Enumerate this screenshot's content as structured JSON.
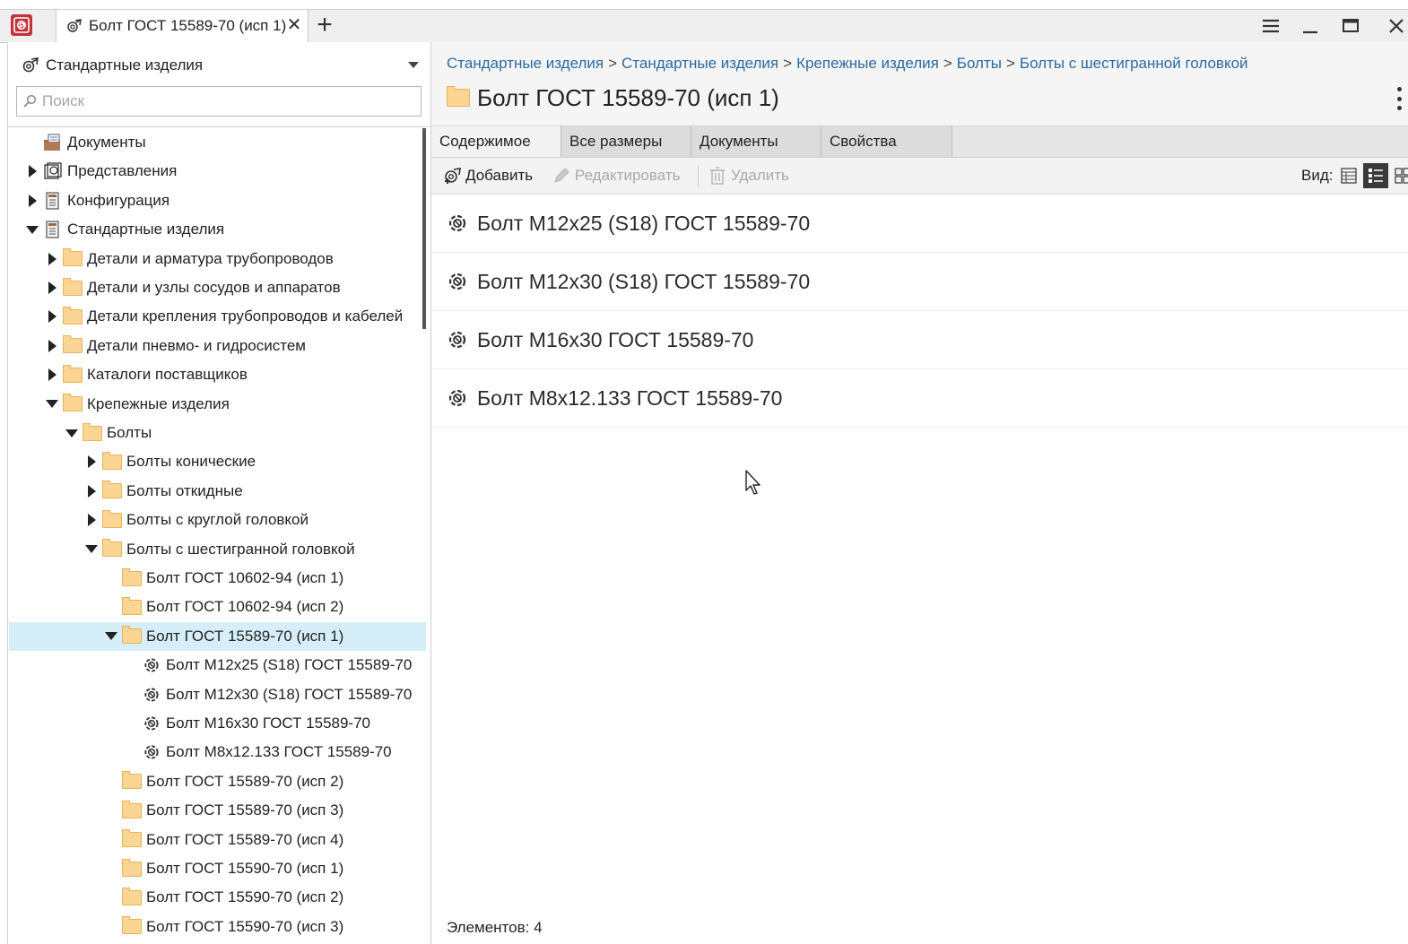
{
  "window": {
    "tab_title": "Болт ГОСТ 15589-70 (исп 1)",
    "tab_close": "✕",
    "new_tab": "+"
  },
  "left": {
    "library_name": "Стандартные изделия",
    "search_placeholder": "Поиск",
    "tree": [
      {
        "label": "Документы",
        "level": 1,
        "expander": "none",
        "icon": "documents-icon"
      },
      {
        "label": "Представления",
        "level": 1,
        "expander": "collapsed",
        "icon": "views-icon"
      },
      {
        "label": "Конфигурация",
        "level": 1,
        "expander": "collapsed",
        "icon": "config-icon"
      },
      {
        "label": "Стандартные изделия",
        "level": 1,
        "expander": "expanded",
        "icon": "config-icon"
      },
      {
        "label": "Детали и арматура трубопроводов",
        "level": 2,
        "expander": "collapsed",
        "icon": "folder-icon"
      },
      {
        "label": "Детали и узлы сосудов и аппаратов",
        "level": 2,
        "expander": "collapsed",
        "icon": "folder-icon"
      },
      {
        "label": "Детали крепления трубопроводов и кабелей",
        "level": 2,
        "expander": "collapsed",
        "icon": "folder-icon"
      },
      {
        "label": "Детали пневмо- и гидросистем",
        "level": 2,
        "expander": "collapsed",
        "icon": "folder-icon"
      },
      {
        "label": "Каталоги поставщиков",
        "level": 2,
        "expander": "collapsed",
        "icon": "folder-icon"
      },
      {
        "label": "Крепежные изделия",
        "level": 2,
        "expander": "expanded",
        "icon": "folder-icon"
      },
      {
        "label": "Болты",
        "level": 3,
        "expander": "expanded",
        "icon": "folder-icon"
      },
      {
        "label": "Болты конические",
        "level": 4,
        "expander": "collapsed",
        "icon": "folder-icon"
      },
      {
        "label": "Болты откидные",
        "level": 4,
        "expander": "collapsed",
        "icon": "folder-icon"
      },
      {
        "label": "Болты с круглой головкой",
        "level": 4,
        "expander": "collapsed",
        "icon": "folder-icon"
      },
      {
        "label": "Болты с шестигранной головкой",
        "level": 4,
        "expander": "expanded",
        "icon": "folder-icon"
      },
      {
        "label": "Болт ГОСТ 10602-94 (исп 1)",
        "level": 5,
        "expander": "none",
        "icon": "folder-icon"
      },
      {
        "label": "Болт ГОСТ 10602-94 (исп 2)",
        "level": 5,
        "expander": "none",
        "icon": "folder-icon"
      },
      {
        "label": "Болт ГОСТ 15589-70 (исп 1)",
        "level": 5,
        "expander": "expanded",
        "icon": "folder-icon",
        "selected": true
      },
      {
        "label": "Болт М12х25 (S18) ГОСТ 15589-70",
        "level": 6,
        "expander": "none",
        "icon": "part-icon"
      },
      {
        "label": "Болт М12х30 (S18) ГОСТ 15589-70",
        "level": 6,
        "expander": "none",
        "icon": "part-icon"
      },
      {
        "label": "Болт М16х30 ГОСТ 15589-70",
        "level": 6,
        "expander": "none",
        "icon": "part-icon"
      },
      {
        "label": "Болт М8х12.133 ГОСТ 15589-70",
        "level": 6,
        "expander": "none",
        "icon": "part-icon"
      },
      {
        "label": "Болт ГОСТ 15589-70 (исп 2)",
        "level": 5,
        "expander": "none",
        "icon": "folder-icon"
      },
      {
        "label": "Болт ГОСТ 15589-70 (исп 3)",
        "level": 5,
        "expander": "none",
        "icon": "folder-icon"
      },
      {
        "label": "Болт ГОСТ 15589-70 (исп 4)",
        "level": 5,
        "expander": "none",
        "icon": "folder-icon"
      },
      {
        "label": "Болт ГОСТ 15590-70 (исп 1)",
        "level": 5,
        "expander": "none",
        "icon": "folder-icon"
      },
      {
        "label": "Болт ГОСТ 15590-70 (исп 2)",
        "level": 5,
        "expander": "none",
        "icon": "folder-icon"
      },
      {
        "label": "Болт ГОСТ 15590-70 (исп 3)",
        "level": 5,
        "expander": "none",
        "icon": "folder-icon"
      }
    ]
  },
  "breadcrumb": [
    "Стандартные изделия",
    "Стандартные изделия",
    "Крепежные изделия",
    "Болты",
    "Болты с шестигранной головкой"
  ],
  "breadcrumb_separator": ">",
  "page_title": "Болт ГОСТ 15589-70 (исп 1)",
  "tabs": [
    {
      "label": "Содержимое",
      "active": true
    },
    {
      "label": "Все размеры",
      "active": false
    },
    {
      "label": "Документы",
      "active": false
    },
    {
      "label": "Свойства",
      "active": false
    }
  ],
  "toolbar": {
    "add_label": "Добавить",
    "edit_label": "Редактировать",
    "delete_label": "Удалить",
    "view_label": "Вид:"
  },
  "content_items": [
    "Болт М12х25 (S18) ГОСТ 15589-70",
    "Болт М12х30 (S18) ГОСТ 15589-70",
    "Болт М16х30 ГОСТ 15589-70",
    "Болт М8х12.133 ГОСТ 15589-70"
  ],
  "status": "Элементов: 4",
  "colors": {
    "accent_link": "#2c6aa0",
    "selected_row": "#d6eef7",
    "folder": "#fad593",
    "app_icon": "#c4323a"
  }
}
